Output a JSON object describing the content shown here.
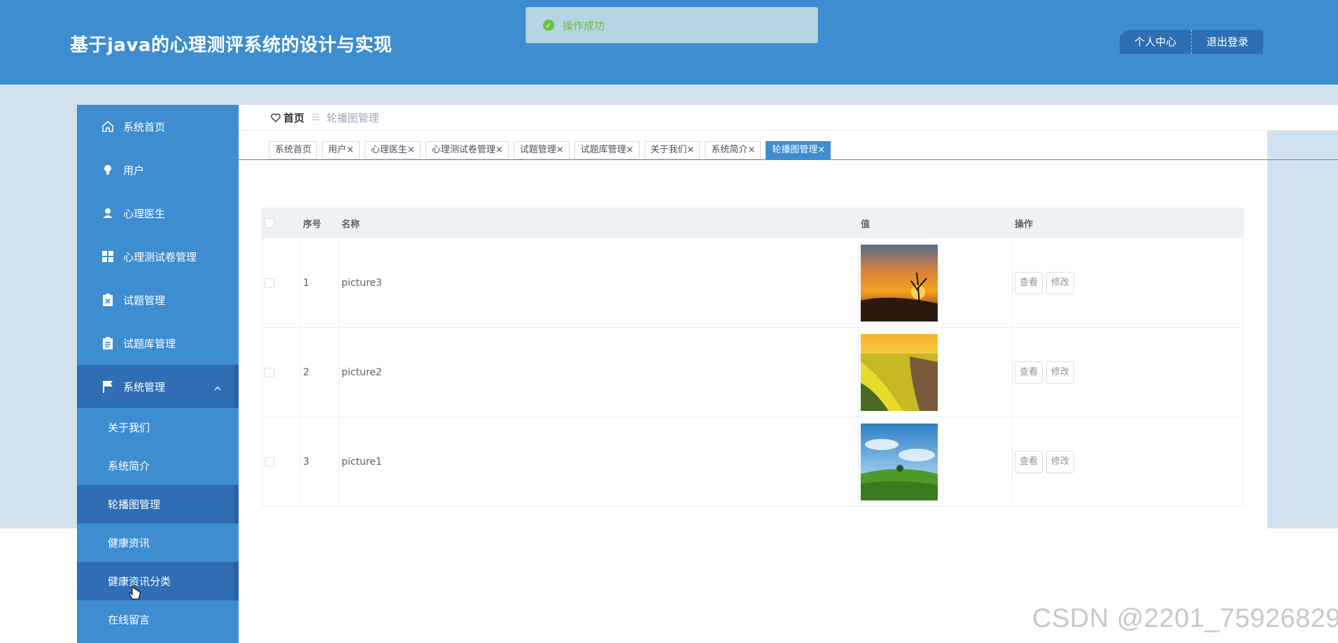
{
  "header": {
    "title": "基于java的心理测评系统的设计与实现",
    "profile_label": "个人中心",
    "logout_label": "退出登录"
  },
  "toast": {
    "message": "操作成功",
    "icon": "check-circle-icon"
  },
  "sidebar": {
    "items": [
      {
        "label": "系统首页",
        "icon": "home-icon"
      },
      {
        "label": "用户",
        "icon": "bulb-icon"
      },
      {
        "label": "心理医生",
        "icon": "user-icon"
      },
      {
        "label": "心理测试卷管理",
        "icon": "grid-icon"
      },
      {
        "label": "试题管理",
        "icon": "clipboard-x-icon"
      },
      {
        "label": "试题库管理",
        "icon": "clipboard-list-icon"
      },
      {
        "label": "系统管理",
        "icon": "flag-icon"
      }
    ],
    "sub_items": [
      {
        "label": "关于我们"
      },
      {
        "label": "系统简介"
      },
      {
        "label": "轮播图管理"
      },
      {
        "label": "健康资讯"
      },
      {
        "label": "健康资讯分类"
      },
      {
        "label": "在线留言"
      }
    ]
  },
  "breadcrumb": {
    "home": "首页",
    "separator": "☰",
    "current": "轮播图管理"
  },
  "tabs": [
    {
      "label": "系统首页"
    },
    {
      "label": "用户×"
    },
    {
      "label": "心理医生×"
    },
    {
      "label": "心理测试卷管理×"
    },
    {
      "label": "试题管理×"
    },
    {
      "label": "试题库管理×"
    },
    {
      "label": "关于我们×"
    },
    {
      "label": "系统简介×"
    },
    {
      "label": "轮播图管理×"
    }
  ],
  "table": {
    "headers": {
      "index": "序号",
      "name": "名称",
      "value": "值",
      "actions": "操作"
    },
    "rows": [
      {
        "index": "1",
        "name": "picture3",
        "image": "sunset-tree-image"
      },
      {
        "index": "2",
        "name": "picture2",
        "image": "rapeseed-field-image"
      },
      {
        "index": "3",
        "name": "picture1",
        "image": "green-hill-image"
      }
    ],
    "view_label": "查看",
    "edit_label": "修改"
  },
  "watermark": "CSDN @2201_75926829",
  "colors": {
    "primary": "#3d8dd0",
    "active": "#2f6db4",
    "success": "#67c23a",
    "content_bg": "#d1e1ee"
  }
}
